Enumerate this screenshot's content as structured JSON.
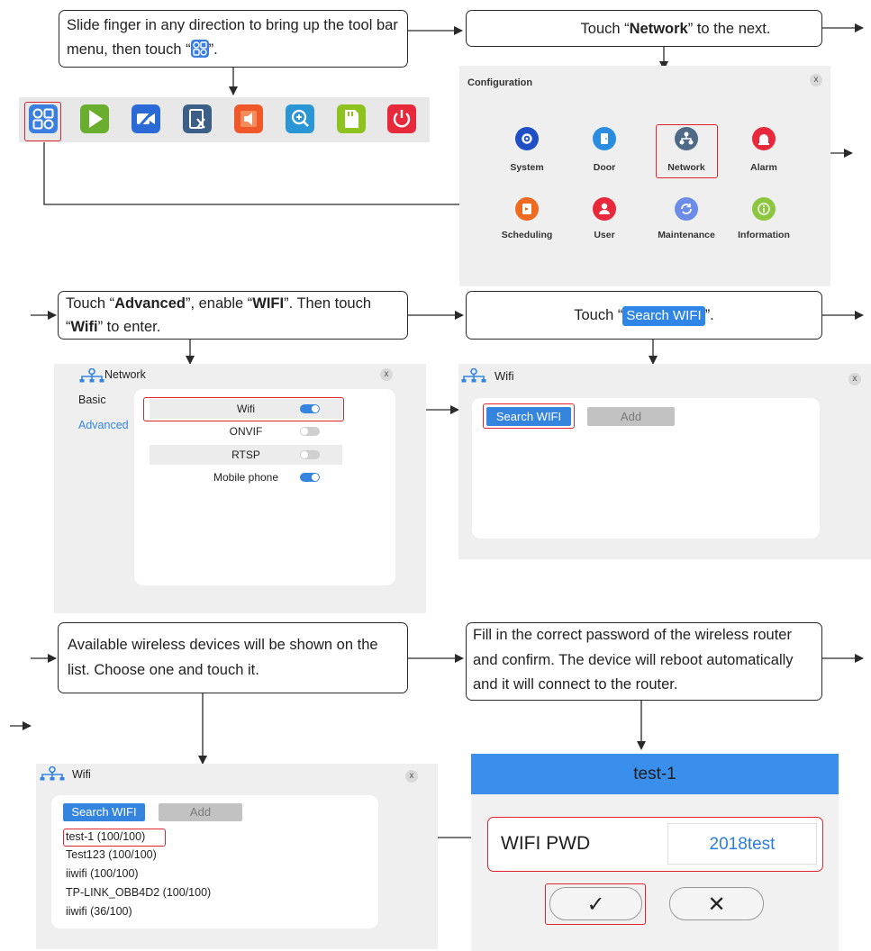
{
  "step1": {
    "text_before": "Slide finger in any direction to bring up the tool bar menu, then touch “",
    "text_after": "”."
  },
  "step2": {
    "text_before": "Touch “",
    "bold": "Network",
    "text_after": "” to the next."
  },
  "step3": {
    "text_a": "Touch “",
    "bold_a": "Advanced",
    "text_b": "”, enable “",
    "bold_b": "WIFI",
    "text_c": "”. Then touch “",
    "bold_c": "Wifi",
    "text_d": "” to enter."
  },
  "step4": {
    "text_before": "Touch “",
    "button": "Search WIFI",
    "text_after": "”."
  },
  "step5": {
    "text": "Available wireless devices will be shown on the list. Choose one and touch it."
  },
  "step6": {
    "text": "Fill in the correct password of the wireless router and confirm. The device will reboot automatically and it will connect to the router."
  },
  "toolbar": {
    "icons": [
      {
        "name": "configuration-icon",
        "color": "#3a7fe0"
      },
      {
        "name": "play-icon",
        "color": "#6aae2e"
      },
      {
        "name": "video-off-icon",
        "color": "#2b6ad6"
      },
      {
        "name": "delete-file-icon",
        "color": "#3b5f86"
      },
      {
        "name": "speaker-icon",
        "color": "#f0582a"
      },
      {
        "name": "zoom-in-icon",
        "color": "#2a96d6"
      },
      {
        "name": "sd-card-icon",
        "color": "#8dc21f"
      },
      {
        "name": "power-icon",
        "color": "#e8283b"
      }
    ]
  },
  "configuration": {
    "title": "Configuration",
    "close": "x",
    "items": [
      {
        "label": "System",
        "color": "#1f4fc4",
        "icon": "gear-icon"
      },
      {
        "label": "Door",
        "color": "#2a8de0",
        "icon": "door-icon"
      },
      {
        "label": "Network",
        "color": "#4e6a86",
        "icon": "network-icon"
      },
      {
        "label": "Alarm",
        "color": "#e8283b",
        "icon": "alarm-icon"
      },
      {
        "label": "Scheduling",
        "color": "#f06a22",
        "icon": "scheduling-icon"
      },
      {
        "label": "User",
        "color": "#e8283b",
        "icon": "user-icon"
      },
      {
        "label": "Maintenance",
        "color": "#6c8ce8",
        "icon": "maintenance-icon"
      },
      {
        "label": "Information",
        "color": "#8cc63f",
        "icon": "info-icon"
      }
    ]
  },
  "network_panel": {
    "title": "Network",
    "close": "x",
    "tabs": [
      "Basic",
      "Advanced"
    ],
    "rows": [
      {
        "label": "Wifi",
        "enabled": true
      },
      {
        "label": "ONVIF",
        "enabled": false
      },
      {
        "label": "RTSP",
        "enabled": false
      },
      {
        "label": "Mobile phone",
        "enabled": true
      }
    ]
  },
  "wifi_panel": {
    "title": "Wifi",
    "close": "x",
    "search_label": "Search WIFI",
    "add_label": "Add"
  },
  "wifi_list_panel": {
    "title": "Wifi",
    "close": "x",
    "search_label": "Search WIFI",
    "add_label": "Add",
    "networks": [
      "test-1 (100/100)",
      "Test123 (100/100)",
      "iiwifi (100/100)",
      "TP-LINK_OBB4D2 (100/100)",
      "iiwifi (36/100)"
    ]
  },
  "password_dialog": {
    "title": "test-1",
    "field_label": "WIFI PWD",
    "field_value": "2018test",
    "confirm_symbol": "✓",
    "cancel_symbol": "✕"
  },
  "colors": {
    "accent_blue": "#3585df",
    "highlight_red": "#e0232f",
    "toggle_on": "#3585df",
    "toggle_off": "#cfcfcf"
  }
}
